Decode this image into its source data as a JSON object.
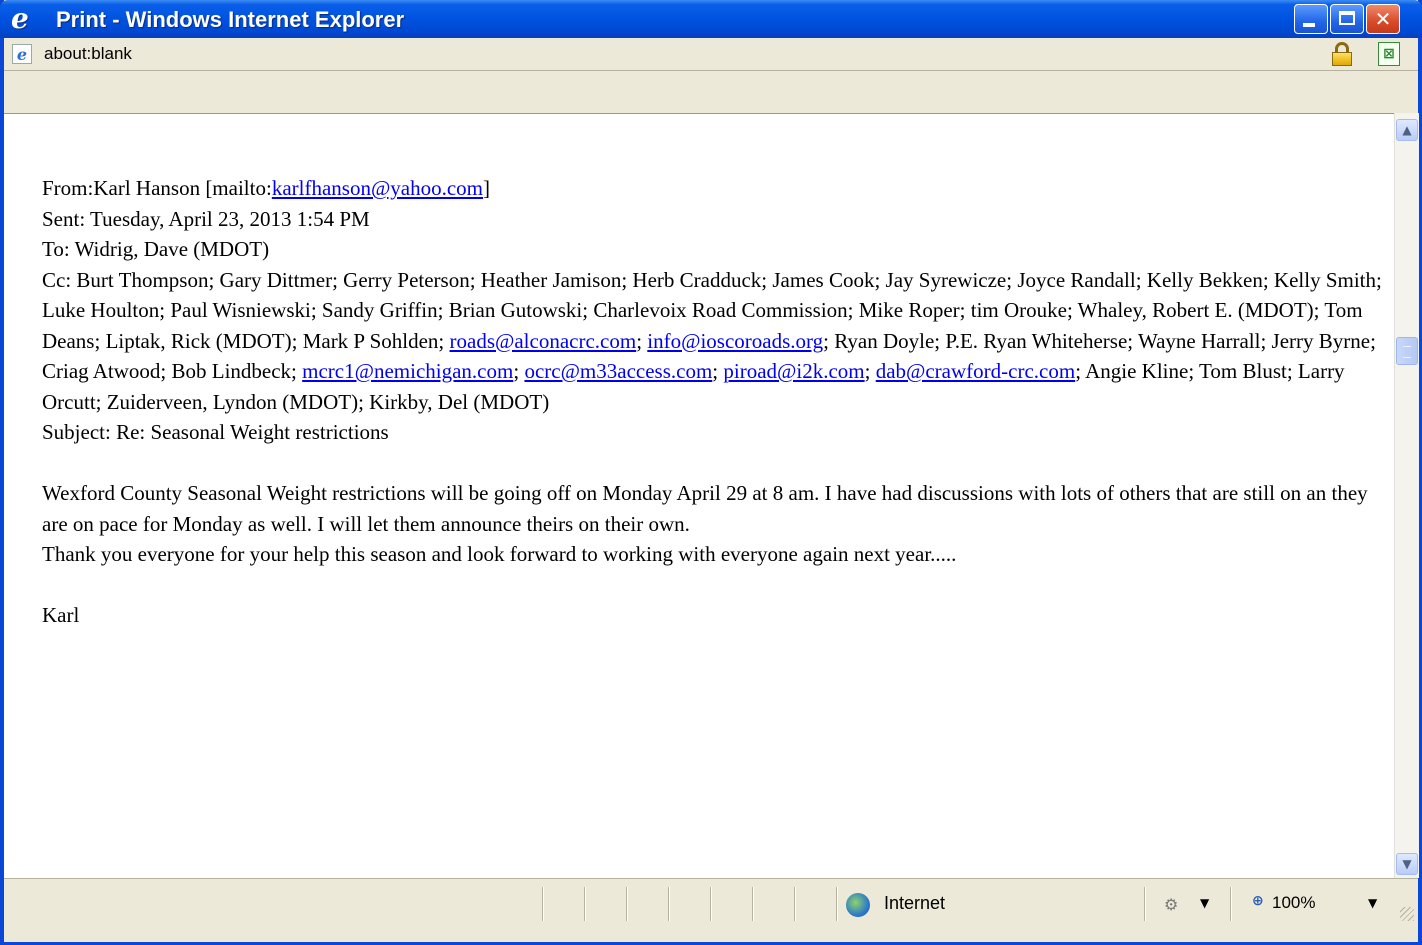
{
  "window": {
    "title": "Print - Windows Internet Explorer",
    "title_icon": "ie-logo-icon",
    "minimize_label": "_",
    "close_label": "✕"
  },
  "address": {
    "url": "about:blank",
    "lock_icon": "lock-icon",
    "report_icon": "report-icon"
  },
  "email": {
    "from_label": "From:",
    "from_name": "Karl Hanson [mailto:",
    "from_email": "karlfhanson@yahoo.com",
    "from_close": "]",
    "sent": "Sent: Tuesday, April 23, 2013 1:54 PM",
    "to": "To: Widrig, Dave (MDOT)",
    "cc_part1": "Cc: Burt Thompson; Gary Dittmer; Gerry Peterson; Heather Jamison; Herb Cradduck; James Cook; Jay Syrewicze; Joyce Randall; Kelly Bekken; Kelly Smith; Luke Houlton; Paul Wisniewski; Sandy Griffin; Brian Gutowski; Charlevoix Road Commission; Mike Roper; tim Orouke; Whaley, Robert E. (MDOT); Tom Deans; Liptak, Rick (MDOT); Mark P Sohlden; ",
    "cc_link1": "roads@alconacrc.com",
    "cc_sep1": "; ",
    "cc_link2": "info@ioscoroads.org",
    "cc_part2": "; Ryan Doyle; P.E. Ryan Whiteherse; Wayne Harrall; Jerry Byrne; Criag Atwood; Bob Lindbeck; ",
    "cc_link3": "mcrc1@nemichigan.com",
    "cc_sep2": "; ",
    "cc_link4": "ocrc@m33access.com",
    "cc_sep3": "; ",
    "cc_link5": "piroad@i2k.com",
    "cc_sep4": "; ",
    "cc_link6": "dab@crawford-crc.com",
    "cc_part3": "; Angie Kline; Tom Blust; Larry Orcutt; Zuiderveen, Lyndon (MDOT); Kirkby, Del (MDOT)",
    "subject": "Subject: Re: Seasonal Weight restrictions",
    "body1": "Wexford County Seasonal Weight restrictions will be going off on Monday April 29 at 8 am.  I have had discussions with lots of others that are still on an they are on pace for Monday as well.  I will let them announce theirs on their own.",
    "body2": "Thank you everyone for your help this season and look forward to working with everyone again next year.....",
    "signature": "Karl"
  },
  "scrollbar": {
    "up_label": "▲",
    "down_label": "▼"
  },
  "status": {
    "zone": "Internet",
    "zoom": "100%",
    "globe_icon": "globe-icon",
    "protected_mode_icon": "protected-mode-icon",
    "zoom_icon": "zoom-icon"
  }
}
